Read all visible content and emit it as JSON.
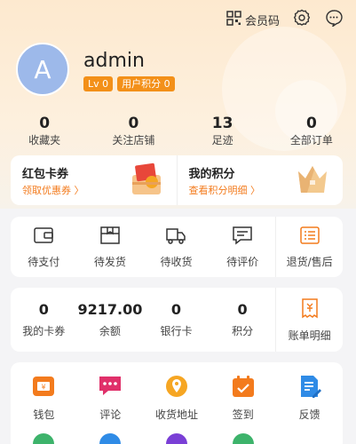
{
  "header": {
    "vip_code_label": "会员码"
  },
  "user": {
    "avatar_letter": "A",
    "name": "admin",
    "level": "Lv 0",
    "points_badge": "用户积分 0"
  },
  "stats": [
    {
      "value": "0",
      "label": "收藏夹"
    },
    {
      "value": "0",
      "label": "关注店铺"
    },
    {
      "value": "13",
      "label": "足迹"
    },
    {
      "value": "0",
      "label": "全部订单"
    }
  ],
  "promo": {
    "coupon": {
      "title": "红包卡券",
      "link": "领取优惠券 〉"
    },
    "points": {
      "title": "我的积分",
      "link": "查看积分明细 〉"
    }
  },
  "orders": [
    {
      "label": "待支付",
      "icon": "wallet-icon"
    },
    {
      "label": "待发货",
      "icon": "box-icon"
    },
    {
      "label": "待收货",
      "icon": "truck-icon"
    },
    {
      "label": "待评价",
      "icon": "comment-icon"
    },
    {
      "label": "退货/售后",
      "icon": "return-list-icon"
    }
  ],
  "wallet": [
    {
      "value": "0",
      "label": "我的卡券"
    },
    {
      "value": "9217.00",
      "label": "余额"
    },
    {
      "value": "0",
      "label": "银行卡"
    },
    {
      "value": "0",
      "label": "积分"
    },
    {
      "label": "账单明细",
      "icon": "bill-icon"
    }
  ],
  "tools": [
    {
      "label": "钱包",
      "icon": "wallet-icon",
      "color": "#f37b1d"
    },
    {
      "label": "评论",
      "icon": "comment-icon",
      "color": "#e0306a"
    },
    {
      "label": "收货地址",
      "icon": "location-icon",
      "color": "#f6a623"
    },
    {
      "label": "签到",
      "icon": "calendar-icon",
      "color": "#f37b1d"
    },
    {
      "label": "反馈",
      "icon": "feedback-icon",
      "color": "#2f8be6"
    }
  ],
  "colors": {
    "accent": "#f37b1d",
    "badge": "#f39019",
    "header_bg": "#fde9cf"
  }
}
